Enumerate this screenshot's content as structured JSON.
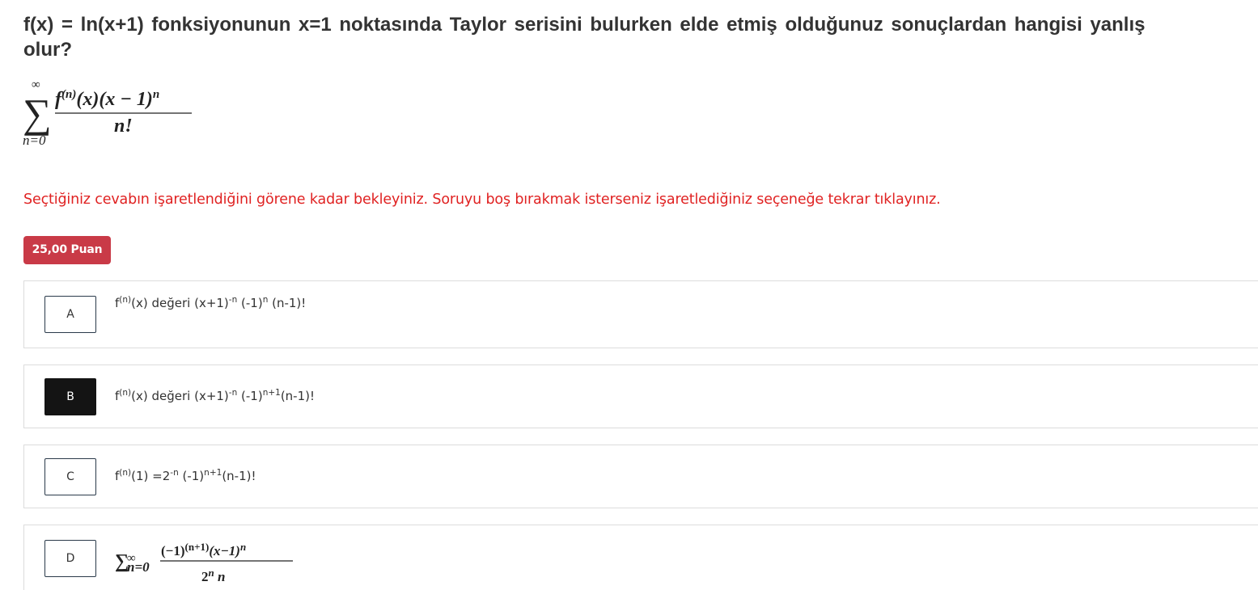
{
  "question": {
    "line1": "f(x) = ln(x+1) fonksiyonunun x=1 noktasında Taylor serisini bulurken elde etmiş olduğunuz sonuçlardan hangisi yanlış",
    "line2": "olur?"
  },
  "formula": {
    "sum_upper": "∞",
    "sum_symbol": "∑",
    "sum_lower": "n=0",
    "numerator_f": "f",
    "numerator_order": "(n)",
    "numerator_rest": "(x)(x − 1)",
    "numerator_power": "n",
    "denominator": "n!"
  },
  "warning": "Seçtiğiniz cevabın işaretlendiğini görene kadar bekleyiniz. Soruyu boş bırakmak isterseniz işaretlediğiniz seçeneğe tekrar tıklayınız.",
  "points_badge": "25,00 Puan",
  "colors": {
    "warning": "#e02222",
    "badge": "#c93a47",
    "selected_letter": "#141414"
  },
  "options": [
    {
      "letter": "A",
      "selected": false,
      "f": "f",
      "order": "(n)",
      "part1": "(x) değeri (x+1)",
      "exp1": "-n",
      "part2": " (-1)",
      "exp2": "n",
      "part3": " (n-1)!"
    },
    {
      "letter": "B",
      "selected": true,
      "f": "f",
      "order": "(n)",
      "part1": "(x) değeri (x+1)",
      "exp1": "-n",
      "part2": " (-1)",
      "exp2": "n+1",
      "part3": "(n-1)!"
    },
    {
      "letter": "C",
      "selected": false,
      "f": "f",
      "order": "(n)",
      "part1": "(1) =2",
      "exp1": "-n",
      "part2": " (-1)",
      "exp2": "n+1",
      "part3": "(n-1)!"
    },
    {
      "letter": "D",
      "selected": false,
      "sum_symbol": "∑",
      "sum_lower": "n=0",
      "sum_upper": "∞",
      "numerator_base": "(−1)",
      "numerator_exp": "(n+1)",
      "numerator_rest": "(x−1)",
      "numerator_power": "n",
      "denominator_base": "2",
      "denominator_exp": "n",
      "denominator_rest": " n"
    }
  ]
}
